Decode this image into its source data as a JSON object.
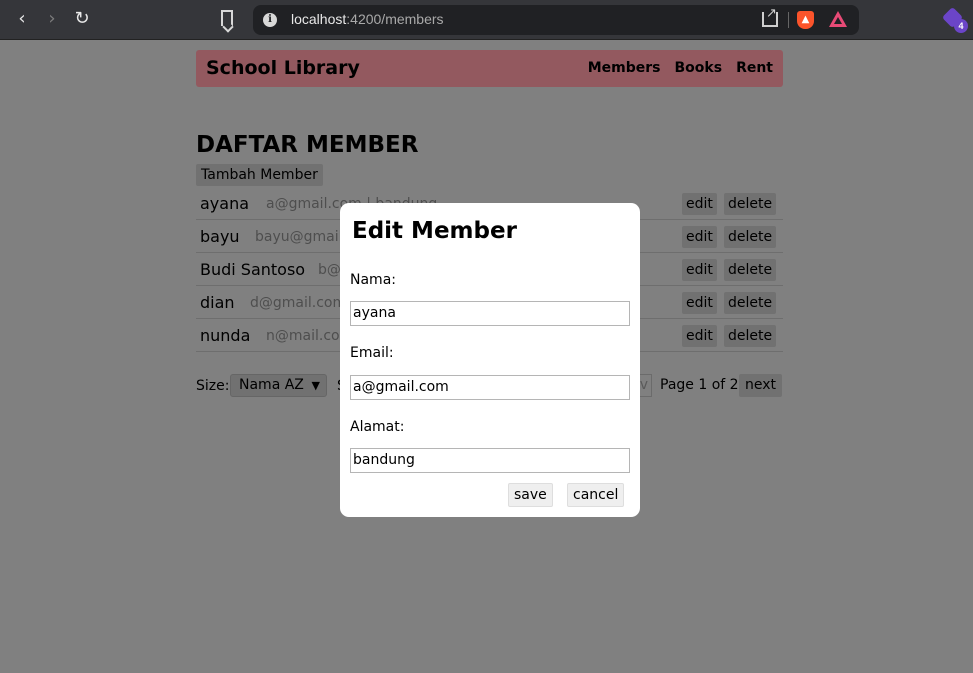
{
  "browser": {
    "url_host": "localhost",
    "url_path": ":4200/members",
    "extension_badge": "4"
  },
  "app": {
    "brand": "School Library",
    "nav": [
      "Members",
      "Books",
      "Rent"
    ]
  },
  "page": {
    "title": "DAFTAR MEMBER",
    "add_button": "Tambah Member",
    "members": [
      {
        "name": "ayana",
        "info": "a@gmail.com | bandung"
      },
      {
        "name": "bayu",
        "info": "bayu@gmail"
      },
      {
        "name": "Budi Santoso",
        "info": "b@"
      },
      {
        "name": "dian",
        "info": "d@gmail.com"
      },
      {
        "name": "nunda",
        "info": "n@mail.com"
      }
    ],
    "row_actions": {
      "edit": "edit",
      "delete": "delete"
    },
    "pager": {
      "size_label": "Size:",
      "sort_selected": "Nama AZ",
      "sort_label_fragment": "S",
      "prev_fragment": "v",
      "page_info": "Page 1 of 2",
      "next": "next"
    }
  },
  "modal": {
    "title": "Edit Member",
    "fields": [
      {
        "label": "Nama:",
        "value": "ayana"
      },
      {
        "label": "Email:",
        "value": "a@gmail.com"
      },
      {
        "label": "Alamat:",
        "value": "bandung"
      }
    ],
    "save": "save",
    "cancel": "cancel"
  },
  "colors": {
    "overlay": "#808080",
    "navbar": "#93595f",
    "modal_bg": "#ffffff",
    "accent_brave": "#fb542b",
    "extension": "#6b45c8"
  }
}
